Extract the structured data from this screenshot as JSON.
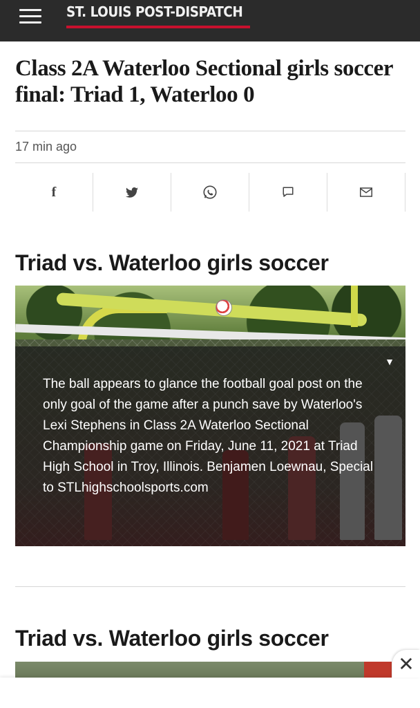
{
  "header": {
    "brand": "ST. LOUIS POST-DISPATCH",
    "menu_icon": "hamburger-menu-icon",
    "brand_underline_color": "#c8102e"
  },
  "article": {
    "headline": "Class 2A Waterloo Sectional girls soccer final: Triad 1, Waterloo 0",
    "timestamp": "17 min ago"
  },
  "share": {
    "facebook_glyph": "f",
    "icons": [
      "facebook-icon",
      "twitter-icon",
      "whatsapp-icon",
      "comment-icon",
      "email-icon"
    ]
  },
  "gallery": {
    "title": "Triad vs. Waterloo girls soccer",
    "caption_toggle": "▼",
    "caption": "The ball appears to glance the football goal post on the only goal of the game after a punch save by Waterloo's Lexi Stephens in Class 2A Waterloo Sectional Championship game on Friday, June 11, 2021 at Triad High School in Troy, Illinois. Benjamen Loewnau, Special to STLhighschoolsports.com"
  },
  "gallery2": {
    "title": "Triad vs. Waterloo girls soccer"
  },
  "ad": {
    "close_label": "✕"
  }
}
